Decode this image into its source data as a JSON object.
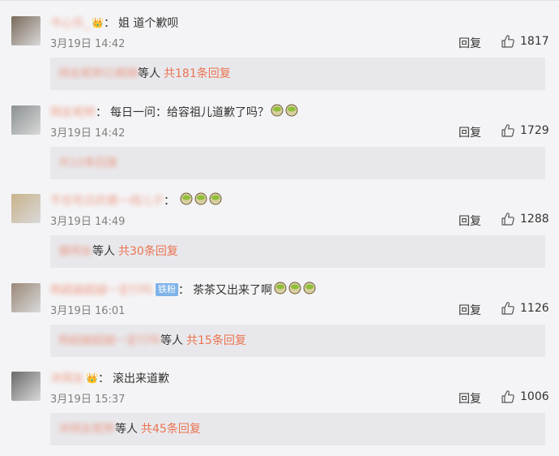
{
  "comments": [
    {
      "username": "今心乐_",
      "has_crown": true,
      "fan_badge": "",
      "text": "姐 道个歉呗",
      "emojis": [],
      "time": "3月19日 14:42",
      "reply_label": "回复",
      "likes": "1817",
      "reply_names": "网友昵称已模糊",
      "reply_people": "等人",
      "reply_count": "共181条回复",
      "avatar_color": "#7a6a5a"
    },
    {
      "username": "网友昵称",
      "has_crown": false,
      "fan_badge": "",
      "text": "每日一问：给容祖儿道歉了吗？",
      "emojis": [
        "matcha-icon",
        "matcha-icon"
      ],
      "time": "3月19日 14:42",
      "reply_label": "回复",
      "likes": "1729",
      "reply_names": "",
      "reply_people": "",
      "reply_count": "共10条回复",
      "avatar_color": "#8a9090"
    },
    {
      "username": "不在吃瓜的第一线儿子",
      "has_crown": false,
      "fan_badge": "",
      "text": "",
      "emojis": [
        "matcha-icon",
        "matcha-icon",
        "matcha-icon"
      ],
      "time": "3月19日 14:49",
      "reply_label": "回复",
      "likes": "1288",
      "reply_names": "健网友",
      "reply_people": "等人",
      "reply_count": "共30条回复",
      "avatar_color": "#c9b28a"
    },
    {
      "username": "杨超越超越一定行吗",
      "has_crown": false,
      "fan_badge": "铁粉",
      "text": "茶茶又出来了啊",
      "emojis": [
        "matcha-icon",
        "matcha-icon",
        "matcha-icon"
      ],
      "time": "3月19日 16:01",
      "reply_label": "回复",
      "likes": "1126",
      "reply_names": "杨超越超越一定行吗",
      "reply_people": "等人",
      "reply_count": "共15条回复",
      "avatar_color": "#9a8878"
    },
    {
      "username": "沐网友",
      "has_crown": true,
      "fan_badge": "",
      "text": "滚出来道歉",
      "emojis": [],
      "time": "3月19日 15:37",
      "reply_label": "回复",
      "likes": "1006",
      "reply_names": "沐网友昵称",
      "reply_people": "等人",
      "reply_count": "共45条回复",
      "avatar_color": "#6a6a6a"
    }
  ]
}
